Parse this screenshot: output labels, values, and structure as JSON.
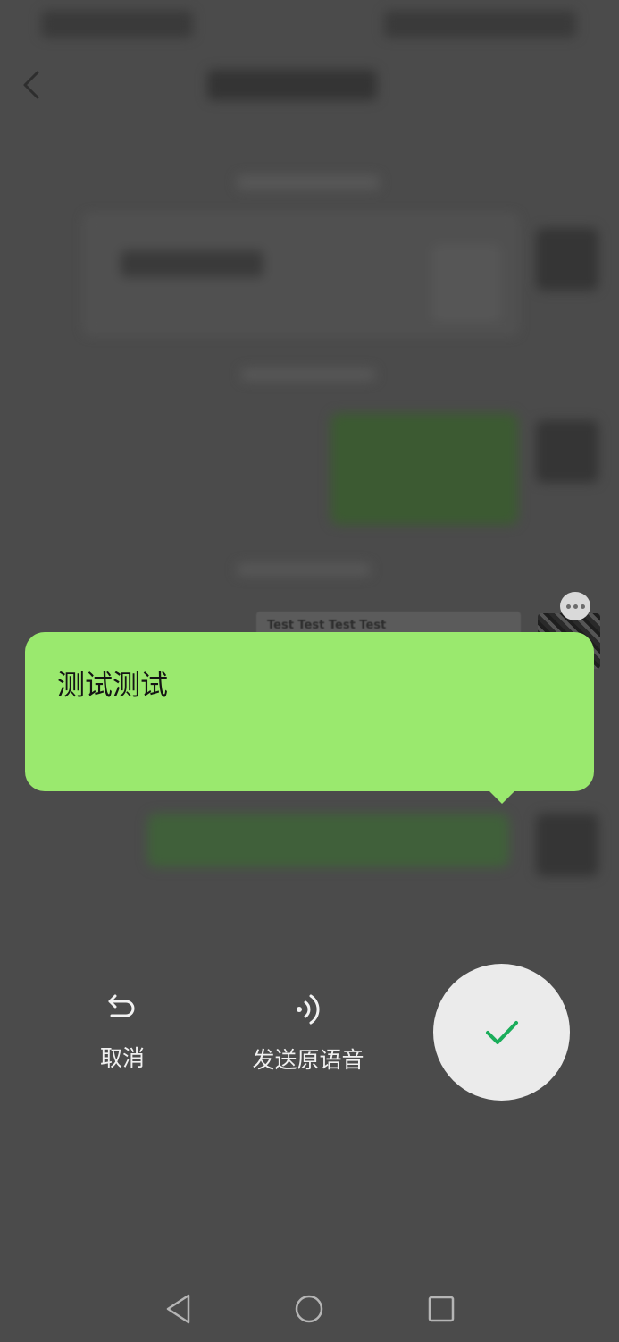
{
  "chat_preview": {
    "card_text": "Test Test Test Test"
  },
  "transcription": {
    "text": "测试测试"
  },
  "actions": {
    "cancel_label": "取消",
    "send_raw_voice_label": "发送原语音"
  },
  "colors": {
    "bubble": "#9ae96e",
    "confirm_check": "#1aad5a",
    "overlay": "#4b4b4b"
  },
  "icons": {
    "back": "chevron-left",
    "more": "ellipsis",
    "cancel": "undo-arrow",
    "send_raw": "sound-wave",
    "confirm": "checkmark",
    "nav_back": "triangle-left",
    "nav_home": "circle",
    "nav_recent": "square"
  }
}
